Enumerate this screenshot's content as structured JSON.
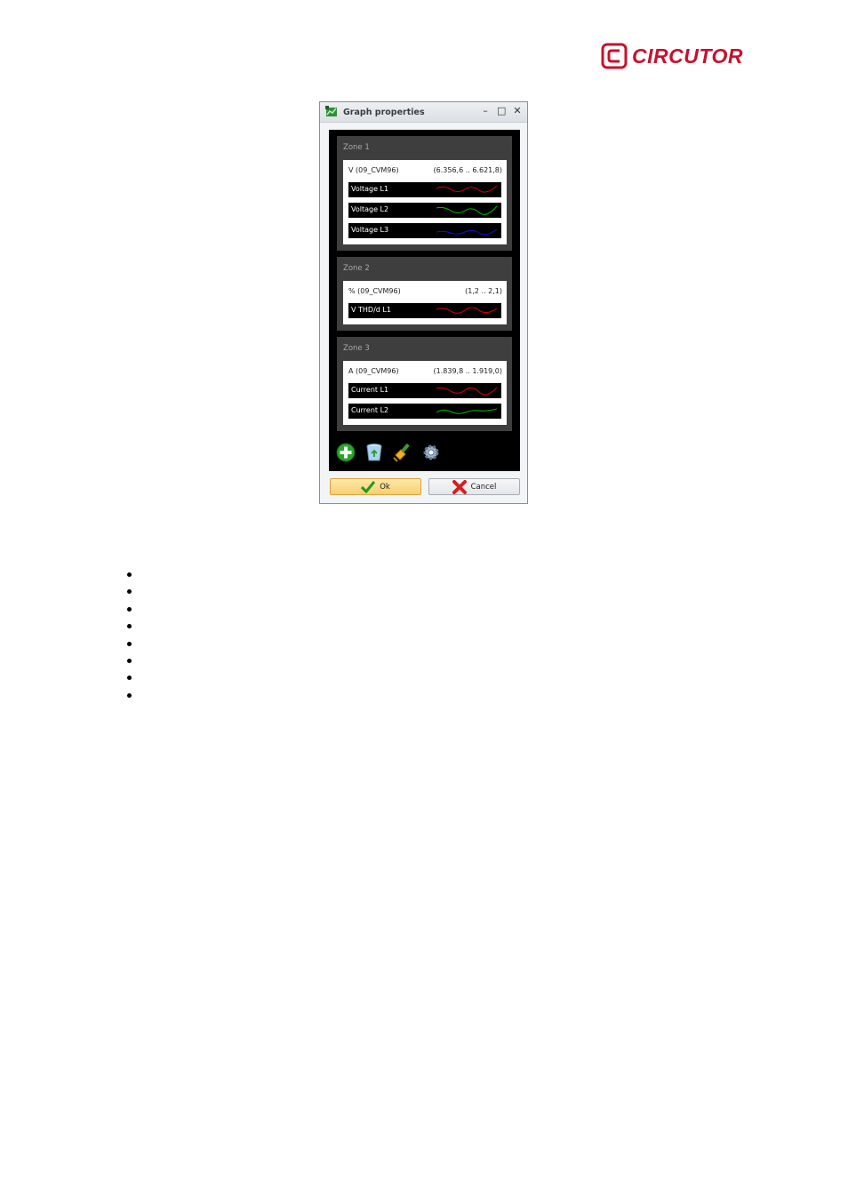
{
  "brand": {
    "name": "CIRCUTOR",
    "color": "#c8102e"
  },
  "dialog": {
    "title": "Graph properties",
    "window_buttons": {
      "minimize": "–",
      "maximize": "□",
      "close": "✕"
    },
    "zones": [
      {
        "title": "Zone 1",
        "unit": "V (09_CVM96)",
        "range": "(6.356,6 .. 6.621,8)",
        "series": [
          {
            "label": "Voltage L1",
            "color": "#e00000"
          },
          {
            "label": "Voltage L2",
            "color": "#00c000"
          },
          {
            "label": "Voltage L3",
            "color": "#1010e0"
          }
        ]
      },
      {
        "title": "Zone 2",
        "unit": "% (09_CVM96)",
        "range": "(1,2 .. 2,1)",
        "series": [
          {
            "label": "V THD/d L1",
            "color": "#e00000"
          }
        ]
      },
      {
        "title": "Zone 3",
        "unit": "A (09_CVM96)",
        "range": "(1.839,8 .. 1.919,0)",
        "series": [
          {
            "label": "Current L1",
            "color": "#e00000"
          },
          {
            "label": "Current L2",
            "color": "#00c000"
          }
        ]
      }
    ],
    "toolbar": [
      {
        "icon": "add-icon"
      },
      {
        "icon": "recycle-bin-icon"
      },
      {
        "icon": "brush-icon"
      },
      {
        "icon": "settings-gear-icon"
      }
    ],
    "ok_label": "Ok",
    "cancel_label": "Cancel"
  },
  "bullet_count": 8
}
